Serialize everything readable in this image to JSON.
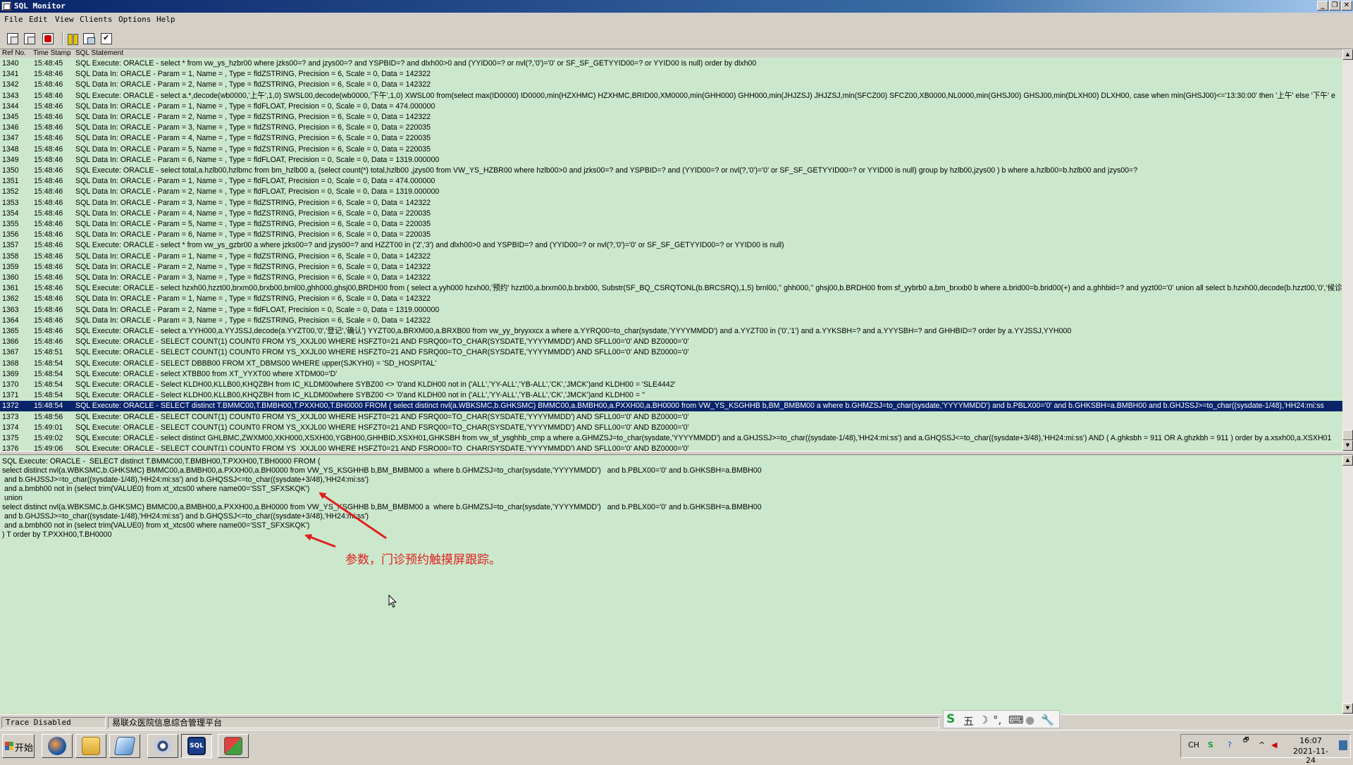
{
  "window": {
    "title": "SQL Monitor"
  },
  "menu": [
    "File",
    "Edit",
    "View",
    "Clients",
    "Options",
    "Help"
  ],
  "toolbar_icons": [
    "copy-icon",
    "paste-icon",
    "clear-icon",
    "pause-icon",
    "window-icon",
    "checklist-icon"
  ],
  "log": {
    "columns": [
      "Ref No.",
      "Time Stamp",
      "SQL Statement"
    ],
    "selected_index": 32,
    "rows": [
      [
        "1340",
        "15:48:45",
        "SQL Execute: ORACLE - select * from vw_ys_hzbr00 where jzks00=? and jzys00=? and YSPBID=? and dlxh00>0  and (YYID00=? or nvl(?,'0')='0' or SF_SF_GETYYID00=? or YYID00 is null)  order by dlxh00"
      ],
      [
        "1341",
        "15:48:46",
        "SQL Data In: ORACLE - Param = 1, Name = , Type = fldZSTRING, Precision = 6, Scale = 0, Data = 142322"
      ],
      [
        "1342",
        "15:48:46",
        "SQL Data In: ORACLE - Param = 2, Name = , Type = fldZSTRING, Precision = 6, Scale = 0, Data = 142322"
      ],
      [
        "1343",
        "15:48:46",
        "SQL Execute: ORACLE - select a.*,decode(wb0000,'上午',1,0) SWSL00,decode(wb0000,'下午',1,0) XWSL00 from(select max(ID0000) ID0000,min(HZXHMC) HZXHMC,BRID00,XM0000,min(GHH000) GHH000,min(JHJZSJ) JHJZSJ,min(SFCZ00) SFCZ00,XB0000,NL0000,min(GHSJ00) GHSJ00,min(DLXH00) DLXH00, case when min(GHSJ00)<='13:30:00' then '上午' else '下午' e"
      ],
      [
        "1344",
        "15:48:46",
        "SQL Data In: ORACLE - Param = 1, Name = , Type = fldFLOAT, Precision = 0, Scale = 0, Data = 474.000000"
      ],
      [
        "1345",
        "15:48:46",
        "SQL Data In: ORACLE - Param = 2, Name = , Type = fldZSTRING, Precision = 6, Scale = 0, Data = 142322"
      ],
      [
        "1346",
        "15:48:46",
        "SQL Data In: ORACLE - Param = 3, Name = , Type = fldZSTRING, Precision = 6, Scale = 0, Data = 220035"
      ],
      [
        "1347",
        "15:48:46",
        "SQL Data In: ORACLE - Param = 4, Name = , Type = fldZSTRING, Precision = 6, Scale = 0, Data = 220035"
      ],
      [
        "1348",
        "15:48:46",
        "SQL Data In: ORACLE - Param = 5, Name = , Type = fldZSTRING, Precision = 6, Scale = 0, Data = 220035"
      ],
      [
        "1349",
        "15:48:46",
        "SQL Data In: ORACLE - Param = 6, Name = , Type = fldFLOAT, Precision = 0, Scale = 0, Data = 1319.000000"
      ],
      [
        "1350",
        "15:48:46",
        "SQL Execute: ORACLE - select total,a.hzlb00,hzlbmc from bm_hzlb00 a, (select count(*) total,hzlb00 ,jzys00 from VW_YS_HZBR00  where hzlb00>0 and jzks00=? and YSPBID=? and (YYID00=? or nvl(?,'0')='0' or SF_SF_GETYYID00=? or YYID00 is null) group by hzlb00,jzys00 ) b  where  a.hzlb00=b.hzlb00 and jzys00=?"
      ],
      [
        "1351",
        "15:48:46",
        "SQL Data In: ORACLE - Param = 1, Name = , Type = fldFLOAT, Precision = 0, Scale = 0, Data = 474.000000"
      ],
      [
        "1352",
        "15:48:46",
        "SQL Data In: ORACLE - Param = 2, Name = , Type = fldFLOAT, Precision = 0, Scale = 0, Data = 1319.000000"
      ],
      [
        "1353",
        "15:48:46",
        "SQL Data In: ORACLE - Param = 3, Name = , Type = fldZSTRING, Precision = 6, Scale = 0, Data = 142322"
      ],
      [
        "1354",
        "15:48:46",
        "SQL Data In: ORACLE - Param = 4, Name = , Type = fldZSTRING, Precision = 6, Scale = 0, Data = 220035"
      ],
      [
        "1355",
        "15:48:46",
        "SQL Data In: ORACLE - Param = 5, Name = , Type = fldZSTRING, Precision = 6, Scale = 0, Data = 220035"
      ],
      [
        "1356",
        "15:48:46",
        "SQL Data In: ORACLE - Param = 6, Name = , Type = fldZSTRING, Precision = 6, Scale = 0, Data = 220035"
      ],
      [
        "1357",
        "15:48:46",
        "SQL Execute: ORACLE - select * from vw_ys_gzbr00 a where jzks00=?  and jzys00=? and HZZT00 in ('2','3') and  dlxh00>0 and YSPBID=?  and (YYID00=? or nvl(?,'0')='0' or SF_SF_GETYYID00=? or YYID00 is null)"
      ],
      [
        "1358",
        "15:48:46",
        "SQL Data In: ORACLE - Param = 1, Name = , Type = fldZSTRING, Precision = 6, Scale = 0, Data = 142322"
      ],
      [
        "1359",
        "15:48:46",
        "SQL Data In: ORACLE - Param = 2, Name = , Type = fldZSTRING, Precision = 6, Scale = 0, Data = 142322"
      ],
      [
        "1360",
        "15:48:46",
        "SQL Data In: ORACLE - Param = 3, Name = , Type = fldZSTRING, Precision = 6, Scale = 0, Data = 142322"
      ],
      [
        "1361",
        "15:48:46",
        "SQL Execute: ORACLE - select hzxh00,hzzt00,brxm00,brxb00,brnl00,ghh000,ghsj00,BRDH00 from ( select a.yyh000 hzxh00,'预约' hzzt00,a.brxm00,b.brxb00, Substr(SF_BQ_CSRQTONL(b.BRCSRQ),1,5) brnl00,'' ghh000,'' ghsj00,b.BRDH00 from sf_yybrb0 a,bm_brxxb0 b where a.brid00=b.brid00(+) and a.ghhbid=? and yyzt00='0' union all select b.hzxh00,decode(b.hzzt00,'0','候诊"
      ],
      [
        "1362",
        "15:48:46",
        "SQL Data In: ORACLE - Param = 1, Name = , Type = fldZSTRING, Precision = 6, Scale = 0, Data = 142322"
      ],
      [
        "1363",
        "15:48:46",
        "SQL Data In: ORACLE - Param = 2, Name = , Type = fldFLOAT, Precision = 0, Scale = 0, Data = 1319.000000"
      ],
      [
        "1364",
        "15:48:46",
        "SQL Data In: ORACLE - Param = 3, Name = , Type = fldZSTRING, Precision = 6, Scale = 0, Data = 142322"
      ],
      [
        "1365",
        "15:48:46",
        "SQL Execute: ORACLE - select a.YYH000,a.YYJSSJ,decode(a.YYZT00,'0','登记','确认') YYZT00,a.BRXM00,a.BRXB00   from vw_yy_bryyxxcx  a where a.YYRQ00=to_char(sysdate,'YYYYMMDD') and a.YYZT00 in ('0','1')  and a.YYKSBH=? and a.YYYSBH=? and GHHBID=? order by a.YYJSSJ,YYH000"
      ],
      [
        "1366",
        "15:48:46",
        "SQL Execute: ORACLE - SELECT COUNT(1) COUNT0 FROM YS_XXJL00 WHERE HSFZT0=21 AND FSRQ00=TO_CHAR(SYSDATE,'YYYYMMDD') AND SFLL00='0' AND BZ0000='0'"
      ],
      [
        "1367",
        "15:48:51",
        "SQL Execute: ORACLE - SELECT COUNT(1) COUNT0 FROM YS_XXJL00 WHERE HSFZT0=21 AND FSRQ00=TO_CHAR(SYSDATE,'YYYYMMDD') AND SFLL00='0' AND BZ0000='0'"
      ],
      [
        "1368",
        "15:48:54",
        "SQL Execute: ORACLE - SELECT DBBB00 FROM XT_DBMS00 WHERE upper(SJKYH0) = 'SD_HOSPITAL'"
      ],
      [
        "1369",
        "15:48:54",
        "SQL Execute: ORACLE - select XTBB00 from XT_YYXT00 where XTDM00='D'"
      ],
      [
        "1370",
        "15:48:54",
        "SQL Execute: ORACLE - Select KLDH00,KLLB00,KHQZBH from IC_KLDM00where SYBZ00 <> '0'and KLDH00 not in ('ALL','YY-ALL','YB-ALL','CK','JMCK')and KLDH00 = 'SLE4442'"
      ],
      [
        "1371",
        "15:48:54",
        "SQL Execute: ORACLE - Select KLDH00,KLLB00,KHQZBH from IC_KLDM00where SYBZ00 <> '0'and KLDH00 not in ('ALL','YY-ALL','YB-ALL','CK','JMCK')and KLDH00 = ''"
      ],
      [
        "1372",
        "15:48:54",
        "SQL Execute: ORACLE -  SELECT distinct T.BMMC00,T.BMBH00,T.PXXH00,T.BH0000 FROM ( select distinct nvl(a.WBKSMC,b.GHKSMC) BMMC00,a.BMBH00,a.PXXH00,a.BH0000 from VW_YS_KSGHHB b,BM_BMBM00 a  where b.GHMZSJ=to_char(sysdate,'YYYYMMDD')   and b.PBLX00='0' and b.GHKSBH=a.BMBH00   and b.GHJSSJ>=to_char((sysdate-1/48),'HH24:mi:ss"
      ],
      [
        "1373",
        "15:48:56",
        "SQL Execute: ORACLE - SELECT COUNT(1) COUNT0 FROM YS_XXJL00 WHERE HSFZT0=21 AND FSRQ00=TO_CHAR(SYSDATE,'YYYYMMDD') AND SFLL00='0' AND BZ0000='0'"
      ],
      [
        "1374",
        "15:49:01",
        "SQL Execute: ORACLE - SELECT COUNT(1) COUNT0 FROM YS_XXJL00 WHERE HSFZT0=21 AND FSRQ00=TO_CHAR(SYSDATE,'YYYYMMDD') AND SFLL00='0' AND BZ0000='0'"
      ],
      [
        "1375",
        "15:49:02",
        "SQL Execute: ORACLE - select distinct GHLBMC,ZWXM00,XKH000,XSXH00,YGBH00,GHHBID,XSXH01,GHKSBH from vw_sf_ysghhb_cmp a where a.GHMZSJ=to_char(sysdate,'YYYYMMDD')    and a.GHJSSJ>=to_char((sysdate-1/48),'HH24:mi:ss') and a.GHQSSJ<=to_char((sysdate+3/48),'HH24:mi:ss') AND ( A.ghksbh = 911 OR A.ghzkbh = 911 ) order by a.xsxh00,a.XSXH01"
      ],
      [
        "1376",
        "15:49:06",
        "SQL Execute: ORACLE - SELECT COUNT(1) COUNT0 FROM YS_XXJL00 WHERE HSFZT0=21 AND FSRQ00=TO_CHAR(SYSDATE,'YYYYMMDD') AND SFLL00='0' AND BZ0000='0'"
      ]
    ]
  },
  "detail": {
    "lines": [
      "SQL Execute: ORACLE -  SELECT distinct T.BMMC00,T.BMBH00,T.PXXH00,T.BH0000 FROM (",
      "select distinct nvl(a.WBKSMC,b.GHKSMC) BMMC00,a.BMBH00,a.PXXH00,a.BH0000 from VW_YS_KSGHHB b,BM_BMBM00 a  where b.GHMZSJ=to_char(sysdate,'YYYYMMDD')   and b.PBLX00='0' and b.GHKSBH=a.BMBH00",
      " and b.GHJSSJ>=to_char((sysdate-1/48),'HH24:mi:ss') and b.GHQSSJ<=to_char((sysdate+3/48),'HH24:mi:ss')",
      " and a.bmbh00 not in (select trim(VALUE0) from xt_xtcs00 where name00='SST_SFXSKQK')",
      " union",
      "select distinct nvl(a.WBKSMC,b.GHKSMC) BMMC00,a.BMBH00,a.PXXH00,a.BH0000 from VW_YS_KSGHHB b,BM_BMBM00 a  where b.GHMZSJ=to_char(sysdate,'YYYYMMDD')   and b.PBLX00='0' and b.GHKSBH=a.BMBH00",
      " and b.GHJSSJ>=to_char((sysdate-1/48),'HH24:mi:ss') and b.GHQSSJ<=to_char((sysdate+3/48),'HH24:mi:ss')",
      " and a.bmbh00 not in (select trim(VALUE0) from xt_xtcs00 where name00='SST_SFXSKQK')",
      ") T order by T.PXXH00,T.BH0000"
    ],
    "annotation": "参数，门诊预约触摸屏跟踪。"
  },
  "statusbar": {
    "trace": "Trace Disabled",
    "app": "易联众医院信息综合管理平台"
  },
  "ime": [
    "五",
    "☽",
    "°,",
    "⌨",
    "●",
    "🔧"
  ],
  "taskbar": {
    "start": "开始",
    "tray_lang": "CH",
    "time": "16:07",
    "date": "2021-11-24"
  },
  "colors": {
    "log_bg": "#cce8cc",
    "selection": "#0a246a",
    "annotation": "#e02020"
  }
}
